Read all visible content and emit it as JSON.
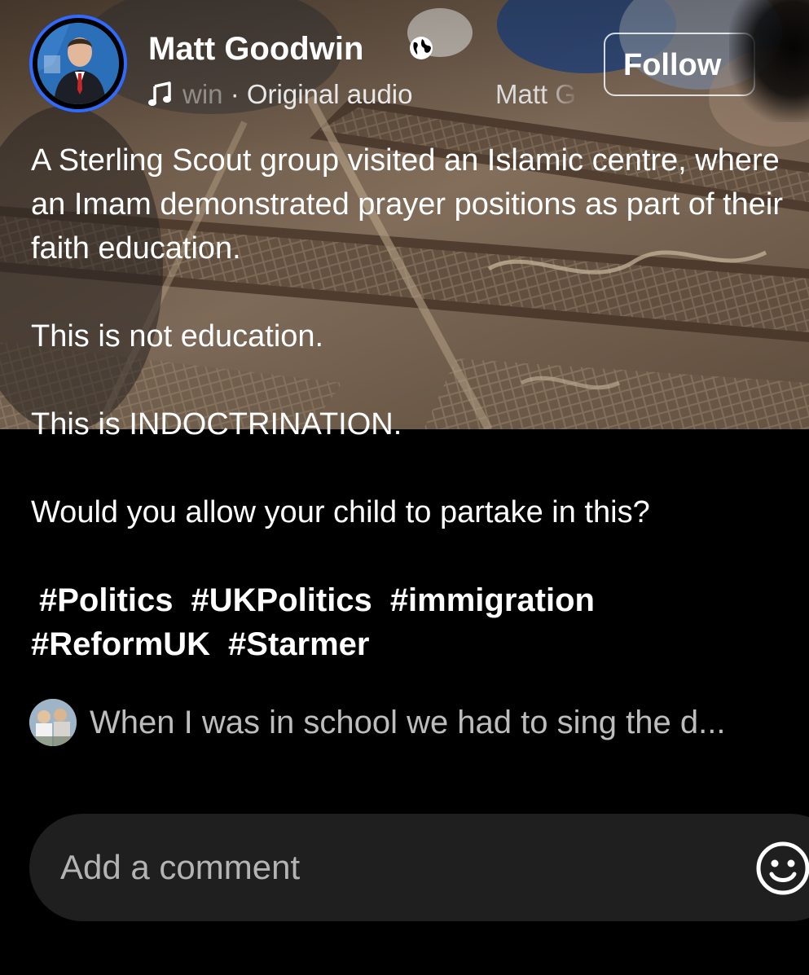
{
  "post": {
    "author_name": "Matt Goodwin",
    "audio_text_faded": "win",
    "audio_text": " · Original audio",
    "audio_scroll_text": "Matt G",
    "follow_label": "Follow",
    "caption": {
      "p1": "A Sterling Scout group visited an Islamic centre, where an Imam demonstrated prayer positions as part of their faith education.",
      "p2": "This is not education.",
      "p3": "This is INDOCTRINATION.",
      "p4": "Would you allow your child to partake in this?"
    },
    "hashtags": [
      "#Politics",
      "#UKPolitics",
      "#immigration",
      "#ReformUK",
      "#Starmer"
    ]
  },
  "comments": {
    "preview_text": "When I was in school we had to sing the d..."
  },
  "comment_input": {
    "placeholder": "Add a comment"
  },
  "icons": {
    "globe": "globe-icon",
    "music": "music-note-icon",
    "emoji": "emoji-smile-icon"
  },
  "colors": {
    "avatar_ring": "#2f6bff",
    "background": "#000000",
    "comment_box": "#1f1f1f"
  }
}
